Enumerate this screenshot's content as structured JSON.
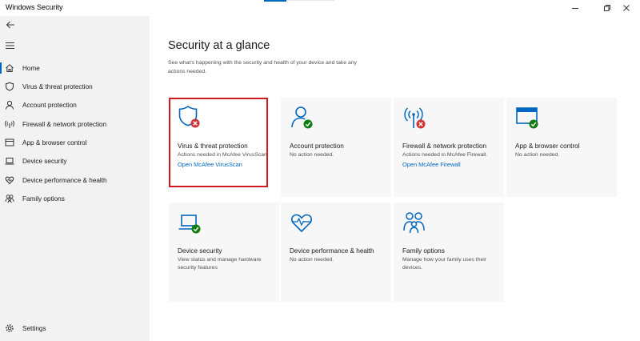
{
  "window": {
    "title": "Windows Security"
  },
  "colors": {
    "accent": "#0067c0",
    "ok": "#107c10",
    "alert": "#d13438",
    "highlight_border": "#d0181f"
  },
  "sidebar": {
    "items": [
      {
        "label": "Home",
        "icon": "home-icon"
      },
      {
        "label": "Virus & threat protection",
        "icon": "shield-icon"
      },
      {
        "label": "Account protection",
        "icon": "person-icon"
      },
      {
        "label": "Firewall & network protection",
        "icon": "antenna-icon"
      },
      {
        "label": "App & browser control",
        "icon": "app-window-icon"
      },
      {
        "label": "Device security",
        "icon": "laptop-icon"
      },
      {
        "label": "Device performance & health",
        "icon": "heart-icon"
      },
      {
        "label": "Family options",
        "icon": "family-icon"
      }
    ],
    "settings_label": "Settings"
  },
  "main": {
    "title": "Security at a glance",
    "subtitle": "See what's happening with the security and health of your device and take any actions needed.",
    "tiles": [
      {
        "title": "Virus & threat protection",
        "desc": "Actions needed in McAfee VirusScan.",
        "link": "Open McAfee VirusScan",
        "status": "alert",
        "icon": "shield-icon"
      },
      {
        "title": "Account protection",
        "desc": "No action needed.",
        "status": "ok",
        "icon": "person-icon"
      },
      {
        "title": "Firewall & network protection",
        "desc": "Actions needed in McAfee Firewall.",
        "link": "Open McAfee Firewall",
        "status": "alert",
        "icon": "antenna-icon"
      },
      {
        "title": "App & browser control",
        "desc": "No action needed.",
        "status": "ok",
        "icon": "app-window-icon"
      },
      {
        "title": "Device security",
        "desc": "View status and manage hardware security features",
        "status": "ok",
        "icon": "laptop-icon"
      },
      {
        "title": "Device performance & health",
        "desc": "No action needed.",
        "status": "none",
        "icon": "heart-icon"
      },
      {
        "title": "Family options",
        "desc": "Manage how your family uses their devices.",
        "status": "none",
        "icon": "family-icon"
      }
    ]
  }
}
